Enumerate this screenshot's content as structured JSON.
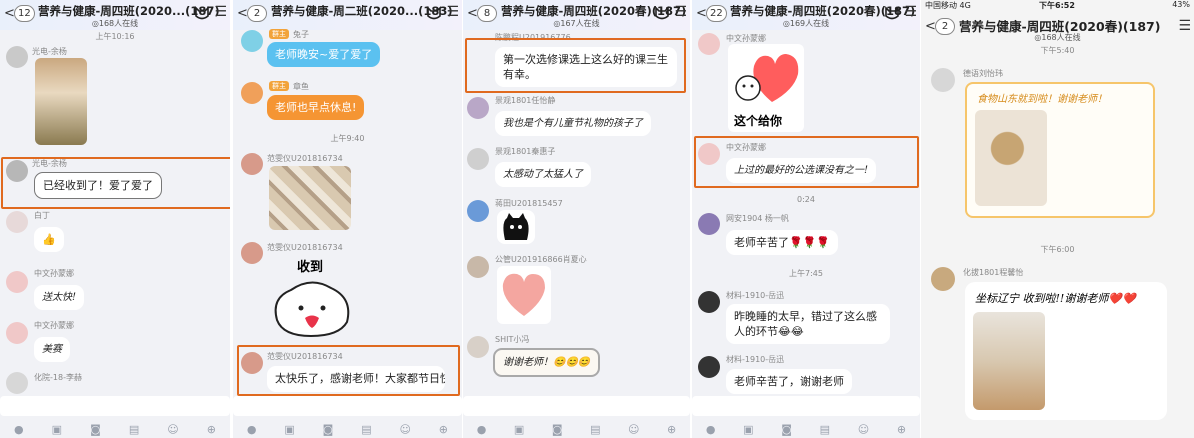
{
  "p1": {
    "count": "12",
    "title": "营养与健康-周四班(2020...(187)",
    "online": "◎168人在线",
    "time": "上午10:16",
    "senders": [
      "光电-余杨",
      "光电-余杨",
      "白丁",
      "中文孙蒙娜",
      "中文孙蒙娜",
      "化院-18-李赫"
    ],
    "msg_received": "已经收到了！爱了爱了",
    "msg_like": "👍",
    "msg_fast": "送太快!",
    "msg_beauty": "美赛"
  },
  "p2": {
    "count": "2",
    "title": "营养与健康-周二班(2020...(183)",
    "senders": [
      "兔子",
      "章鱼",
      "范雯仪U201816734",
      "范雯仪U201816734",
      "范雯仪U201816734"
    ],
    "tag": "群主",
    "msg_goodnight": "老师晚安~爱了爱了",
    "msg_rest": "老师也早点休息!",
    "time": "上午9:40",
    "sticker_text": "收到",
    "msg_happy": "太快乐了，感谢老师！大家都节日快乐！"
  },
  "p3": {
    "count": "8",
    "title": "营养与健康-周四班(2020春)(187)",
    "online": "◎167人在线",
    "senders": [
      "陈鹏程U201916776",
      "景观1801任怡静",
      "景观1801秦惠子",
      "蒋田U201815457",
      "公管U201916866肖夏心",
      "SHIT小冯"
    ],
    "msg_first": "第一次选修课选上这么好的课三生有幸。",
    "msg_gift": "我也是个有儿童节礼物的孩子了",
    "msg_dazed": "太感动了太猛人了",
    "msg_thanks": "谢谢老师！😊😊😊"
  },
  "p4": {
    "count": "22",
    "title": "营养与健康-周四班(2020春)(187)",
    "online": "◎169人在线",
    "senders": [
      "中文孙蒙娜",
      "中文孙蒙娜",
      "网安1904 杨一帆",
      "材料-1910-岳迅",
      "材料-1910-岳迅"
    ],
    "sticker_text": "这个给你",
    "msg_best": "上过的最好的公选课没有之一!",
    "time1": "0:24",
    "msg_hard": "老师辛苦了🌹🌹🌹",
    "time2": "上午7:45",
    "msg_late": "昨晚睡的太早，错过了这么感人的环节😂😂",
    "msg_hard2": "老师辛苦了，谢谢老师"
  },
  "p5": {
    "carrier": "中国移动 4G",
    "clock": "下午6:52",
    "battery": "43%",
    "count": "2",
    "title": "营养与健康-周四班(2020春)(187)",
    "online": "◎168人在线",
    "time1": "下午5:40",
    "sender1": "德语刘怡玮",
    "msg1": "食物山东就到啦！谢谢老师！",
    "time2": "下午6:00",
    "sender2": "化拔1801程馨怡",
    "msg2": "坐标辽宁 收到啦!!谢谢老师❤️❤️"
  },
  "toolbar_icons": [
    "mic-icon",
    "image-icon",
    "camera-icon",
    "file-icon",
    "emoji-icon",
    "plus-icon"
  ],
  "highlight_color": "#e06a1f"
}
